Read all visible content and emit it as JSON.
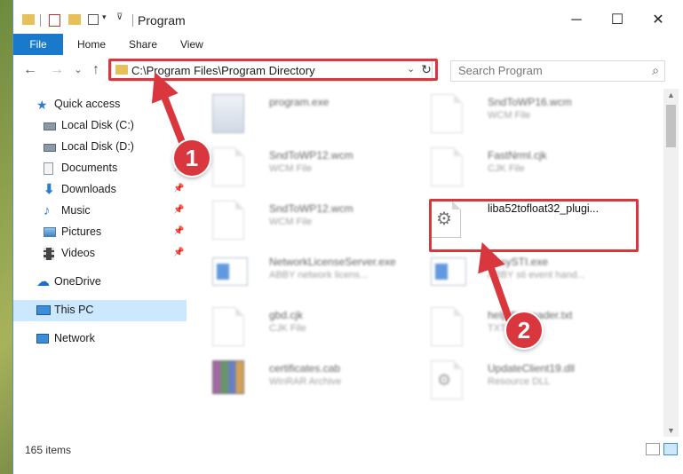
{
  "window": {
    "title": "Program",
    "controls": {
      "minimize": "─",
      "maximize": "☐",
      "close": "✕"
    }
  },
  "ribbon": {
    "tabs": [
      "File",
      "Home",
      "Share",
      "View"
    ],
    "help": "?",
    "collapse": "⌄"
  },
  "nav": {
    "back": "←",
    "forward": "→",
    "recent": "⌄",
    "up": "↑",
    "address": "C:\\Program Files\\Program Directory",
    "address_dropdown": "⌄",
    "refresh": "↻",
    "search_placeholder": "Search Program",
    "search_icon": "⌕"
  },
  "sidebar": {
    "items": [
      {
        "label": "Quick access",
        "icon": "star-icon",
        "pinned": false,
        "selected": false,
        "color": "#2b7cd3"
      },
      {
        "label": "Local Disk (C:)",
        "icon": "drive-icon",
        "pinned": false,
        "selected": false,
        "color": "#6b7a8a"
      },
      {
        "label": "Local Disk (D:)",
        "icon": "drive-icon",
        "pinned": false,
        "selected": false,
        "color": "#6b7a8a"
      },
      {
        "label": "Documents",
        "icon": "documents-icon",
        "pinned": true,
        "selected": false,
        "color": "#8090a0"
      },
      {
        "label": "Downloads",
        "icon": "download-icon",
        "pinned": true,
        "selected": false,
        "color": "#2b7cd3"
      },
      {
        "label": "Music",
        "icon": "music-icon",
        "pinned": true,
        "selected": false,
        "color": "#2b7cd3"
      },
      {
        "label": "Pictures",
        "icon": "pictures-icon",
        "pinned": true,
        "selected": false,
        "color": "#4a8ac8"
      },
      {
        "label": "Videos",
        "icon": "videos-icon",
        "pinned": true,
        "selected": false,
        "color": "#555"
      },
      {
        "label": "OneDrive",
        "icon": "cloud-icon",
        "pinned": false,
        "selected": false,
        "color": "#1c6dd0"
      },
      {
        "label": "This PC",
        "icon": "computer-icon",
        "pinned": false,
        "selected": true,
        "color": "#2b7cd3"
      },
      {
        "label": "Network",
        "icon": "network-icon",
        "pinned": false,
        "selected": false,
        "color": "#2b7cd3"
      }
    ]
  },
  "files": [
    {
      "name": "program.exe",
      "type": "",
      "icon": "exe-icon",
      "blurred": true
    },
    {
      "name": "SndToWP16.wcm",
      "type": "WCM File",
      "icon": "document-icon",
      "blurred": true
    },
    {
      "name": "SndToWP12.wcm",
      "type": "WCM File",
      "icon": "document-icon",
      "blurred": true
    },
    {
      "name": "FastNrml.cjk",
      "type": "CJK File",
      "icon": "document-icon",
      "blurred": true
    },
    {
      "name": "SndToWP12.wcm",
      "type": "WCM File",
      "icon": "document-icon",
      "blurred": true
    },
    {
      "name": "liba52tofloat32_plugi...",
      "type": "",
      "icon": "dll-gear-icon",
      "blurred": false
    },
    {
      "name": "NetworkLicenseServer.exe",
      "type": "ABBY network licens...",
      "icon": "app-icon",
      "blurred": true
    },
    {
      "name": "EasySTI.exe",
      "type": "ABBY sti event hand...",
      "icon": "app-icon",
      "blurred": true
    },
    {
      "name": "gbd.cjk",
      "type": "CJK File",
      "icon": "document-icon",
      "blurred": true
    },
    {
      "name": "help.finereader.txt",
      "type": "TXT File",
      "icon": "document-icon",
      "blurred": true
    },
    {
      "name": "certificates.cab",
      "type": "WinRAR Archive",
      "icon": "rar-icon",
      "blurred": true
    },
    {
      "name": "UpdateClient19.dll",
      "type": "Resource DLL",
      "icon": "dll-gear-icon",
      "blurred": true
    }
  ],
  "status": {
    "item_count": "165 items"
  },
  "annotations": {
    "step1": "1",
    "step2": "2",
    "color": "#d9363e"
  }
}
